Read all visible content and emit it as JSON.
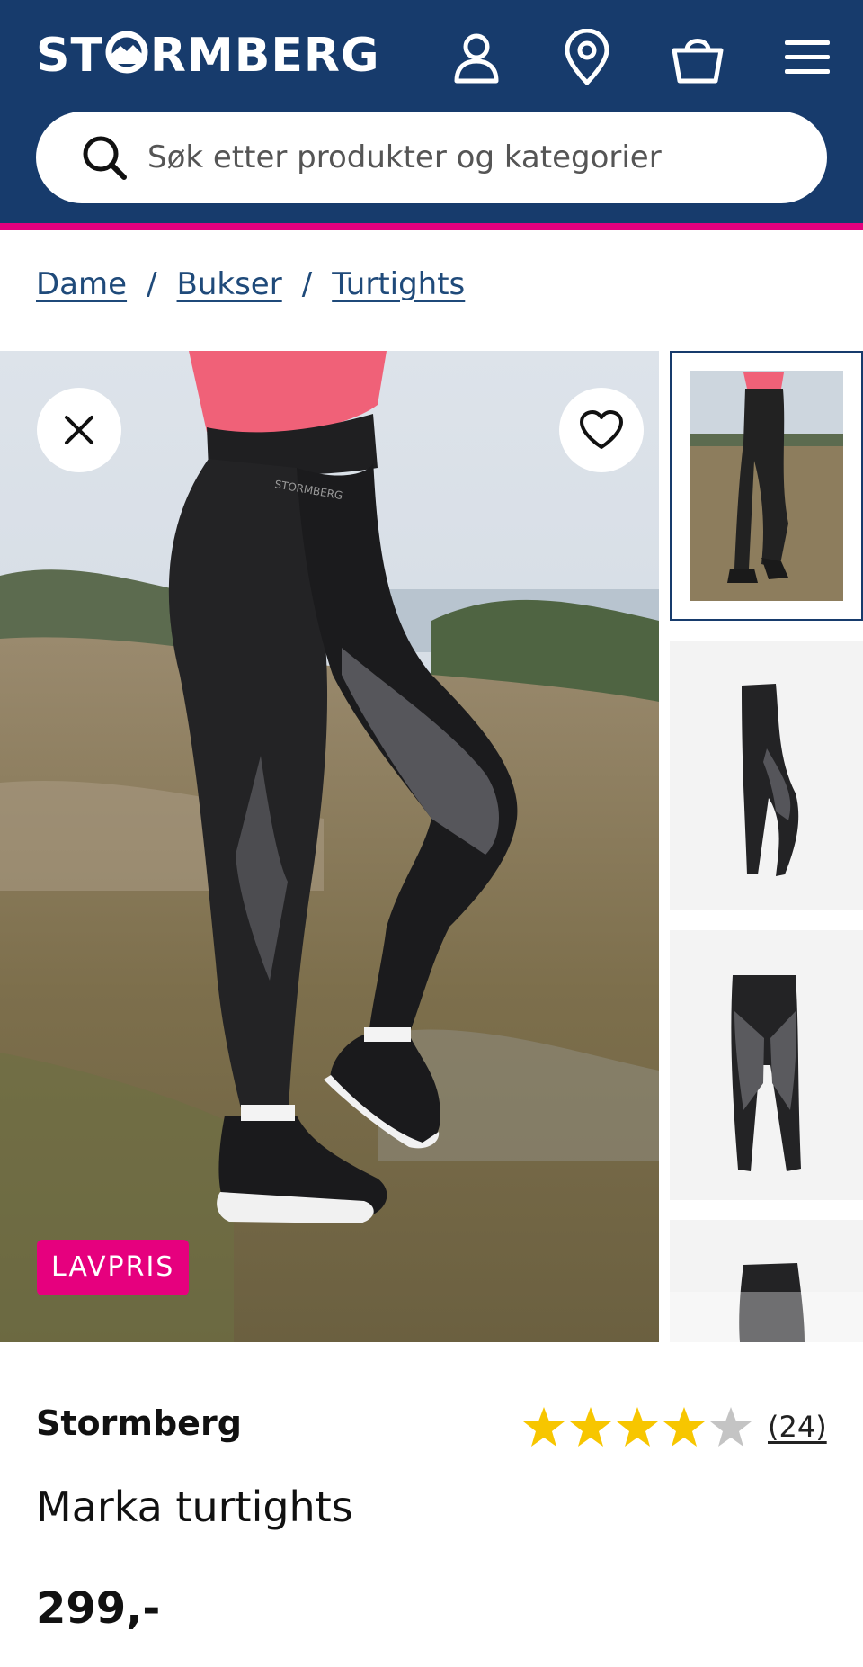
{
  "header": {
    "logo_text_left": "ST",
    "logo_text_right": "RMBERG",
    "icons": [
      "user-icon",
      "location-pin-icon",
      "shopping-bag-icon",
      "hamburger-menu-icon"
    ],
    "search_placeholder": "Søk etter produkter og kategorier"
  },
  "colors": {
    "header_bg": "#173b6c",
    "accent_pink": "#e6007e",
    "link_blue": "#1f4a7a",
    "star_yellow": "#f7c600"
  },
  "breadcrumb": {
    "items": [
      "Dame",
      "Bukser",
      "Turtights"
    ],
    "separator": "/"
  },
  "gallery": {
    "badge": "LAVPRIS",
    "main_image_logo": "STORMBERG",
    "thumbnail_count": 4,
    "active_thumbnail": 1
  },
  "product": {
    "brand": "Stormberg",
    "name": "Marka turtights",
    "rating": 4,
    "rating_max": 5,
    "review_count": "(24)",
    "price": "299,-"
  }
}
